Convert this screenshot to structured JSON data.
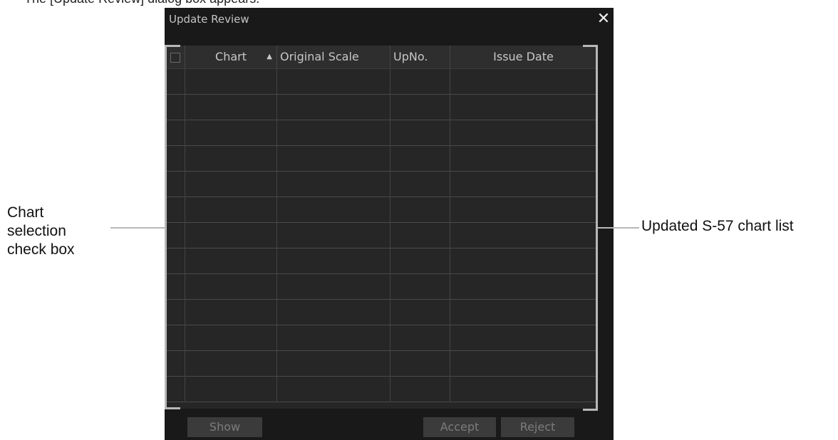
{
  "caption": "The [Update Review] dialog box appears.",
  "dialog": {
    "title": "Update Review",
    "close_glyph": "✕",
    "columns": {
      "chart": "Chart",
      "sort_indicator": "▲",
      "original_scale": "Original Scale",
      "upno": "UpNo.",
      "issue_date": "Issue Date"
    },
    "rows": [
      {},
      {},
      {},
      {},
      {},
      {},
      {},
      {},
      {},
      {},
      {},
      {},
      {}
    ],
    "buttons": {
      "show": "Show",
      "accept": "Accept",
      "reject": "Reject"
    }
  },
  "callouts": {
    "left_label": "Chart selection check box",
    "right_label": "Updated S-57 chart list"
  },
  "colors": {
    "dialog_bg": "#191919",
    "table_bg": "#262626",
    "bracket": "#b8b8b8"
  }
}
